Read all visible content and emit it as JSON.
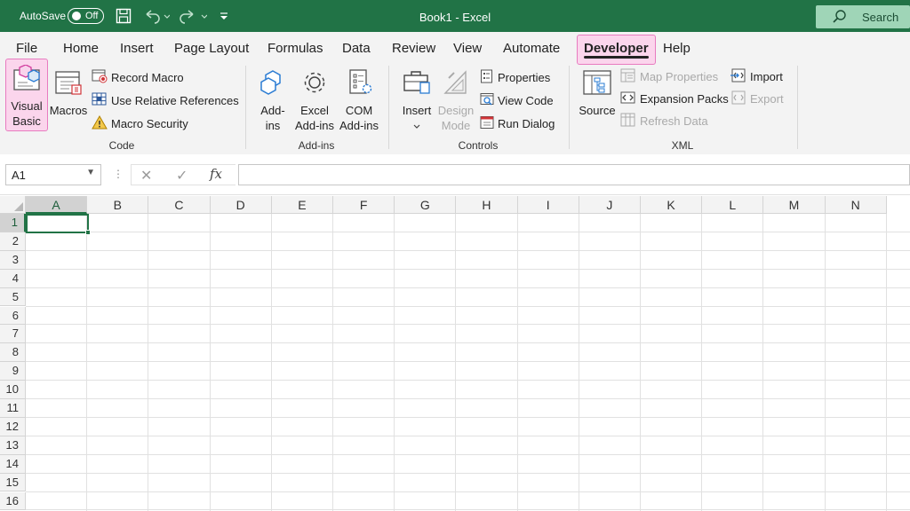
{
  "titlebar": {
    "autosave_label": "AutoSave",
    "autosave_state": "Off",
    "title": "Book1 - Excel",
    "search_label": "Search",
    "icons": [
      "save-icon",
      "undo-icon",
      "redo-icon",
      "customize-qat-icon"
    ]
  },
  "tabs": [
    "File",
    "Home",
    "Insert",
    "Page Layout",
    "Formulas",
    "Data",
    "Review",
    "View",
    "Automate",
    "Developer",
    "Help"
  ],
  "active_tab": "Developer",
  "ribbon": {
    "code": {
      "label": "Code",
      "visual_basic": [
        "Visual",
        "Basic"
      ],
      "macros": "Macros",
      "record_macro": "Record Macro",
      "use_relative": "Use Relative References",
      "macro_security": "Macro Security"
    },
    "addins": {
      "label": "Add-ins",
      "addins": [
        "Add-",
        "ins"
      ],
      "excel_addins": [
        "Excel",
        "Add-ins"
      ],
      "com_addins": [
        "COM",
        "Add-ins"
      ]
    },
    "controls": {
      "label": "Controls",
      "insert": "Insert",
      "design_mode": [
        "Design",
        "Mode"
      ],
      "properties": "Properties",
      "view_code": "View Code",
      "run_dialog": "Run Dialog"
    },
    "xml": {
      "label": "XML",
      "source": "Source",
      "map_properties": "Map Properties",
      "expansion_packs": "Expansion Packs",
      "refresh_data": "Refresh Data",
      "import": "Import",
      "export": "Export"
    }
  },
  "formula_bar": {
    "name_box": "A1",
    "fx": "fx",
    "formula": ""
  },
  "grid": {
    "columns": [
      "A",
      "B",
      "C",
      "D",
      "E",
      "F",
      "G",
      "H",
      "I",
      "J",
      "K",
      "L",
      "M",
      "N"
    ],
    "rows": [
      "1",
      "2",
      "3",
      "4",
      "5",
      "6",
      "7",
      "8",
      "9",
      "10",
      "11",
      "12",
      "13",
      "14",
      "15",
      "16"
    ],
    "active_cell": "A1"
  },
  "colors": {
    "brand": "#217346",
    "highlight": "#fbd5ec",
    "highlight_border": "#e87bc0"
  }
}
